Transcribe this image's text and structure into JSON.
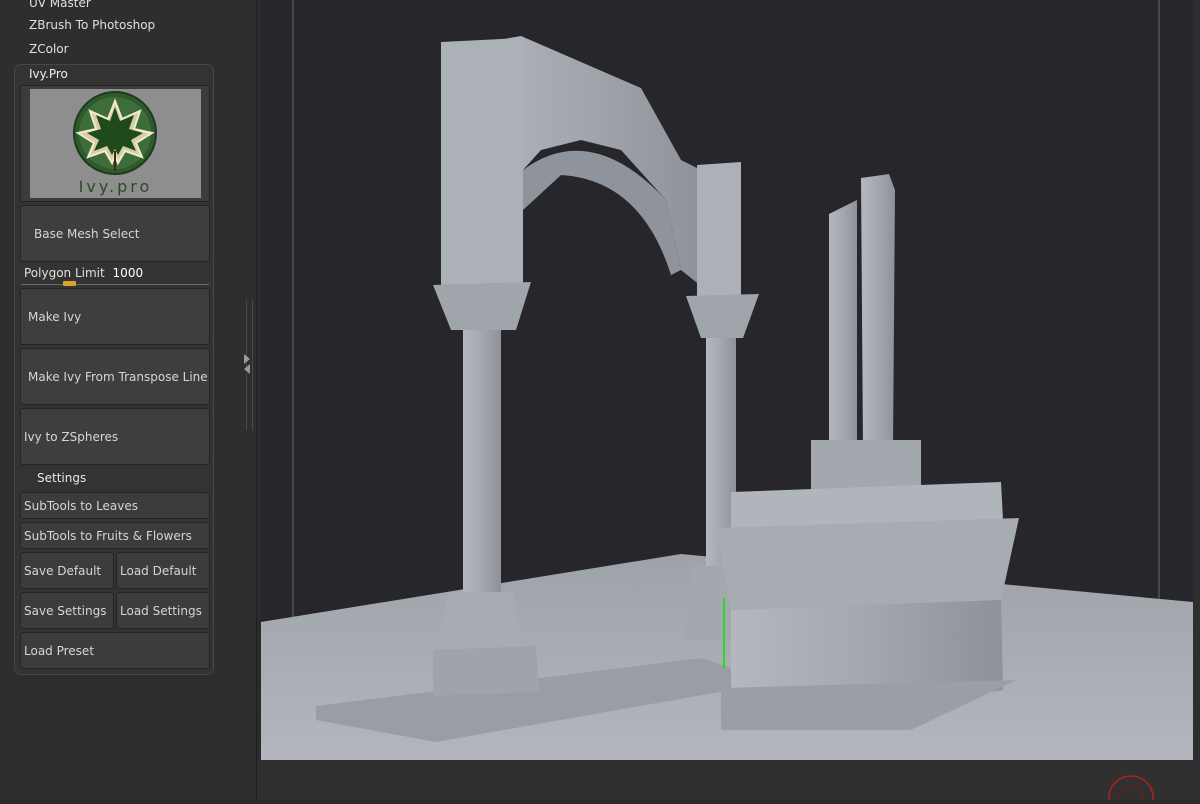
{
  "menu": {
    "items": [
      {
        "label": "UV Master"
      },
      {
        "label": "ZBrush To Photoshop"
      },
      {
        "label": "ZColor"
      }
    ]
  },
  "ivy": {
    "title": "Ivy.Pro",
    "logo_text": "Ivy.pro",
    "base_mesh_select": "Base Mesh Select",
    "polygon_limit_label": "Polygon Limit",
    "polygon_limit_value": "1000",
    "polygon_limit_fraction": 0.26,
    "make_ivy": "Make Ivy",
    "make_ivy_transpose": "Make Ivy From Transpose Line",
    "ivy_to_zspheres": "Ivy to ZSpheres",
    "settings": "Settings",
    "subtools_leaves": "SubTools to Leaves",
    "subtools_fruits": "SubTools to Fruits & Flowers",
    "save_default": "Save Default",
    "load_default": "Load Default",
    "save_settings": "Save Settings",
    "load_settings": "Load Settings",
    "load_preset": "Load Preset"
  },
  "colors": {
    "accent": "#e0a030",
    "viewport_bg": "#26262b",
    "model": "#a7abb2",
    "gizmo_line": "#22dd22",
    "record_ring": "#b02020"
  }
}
